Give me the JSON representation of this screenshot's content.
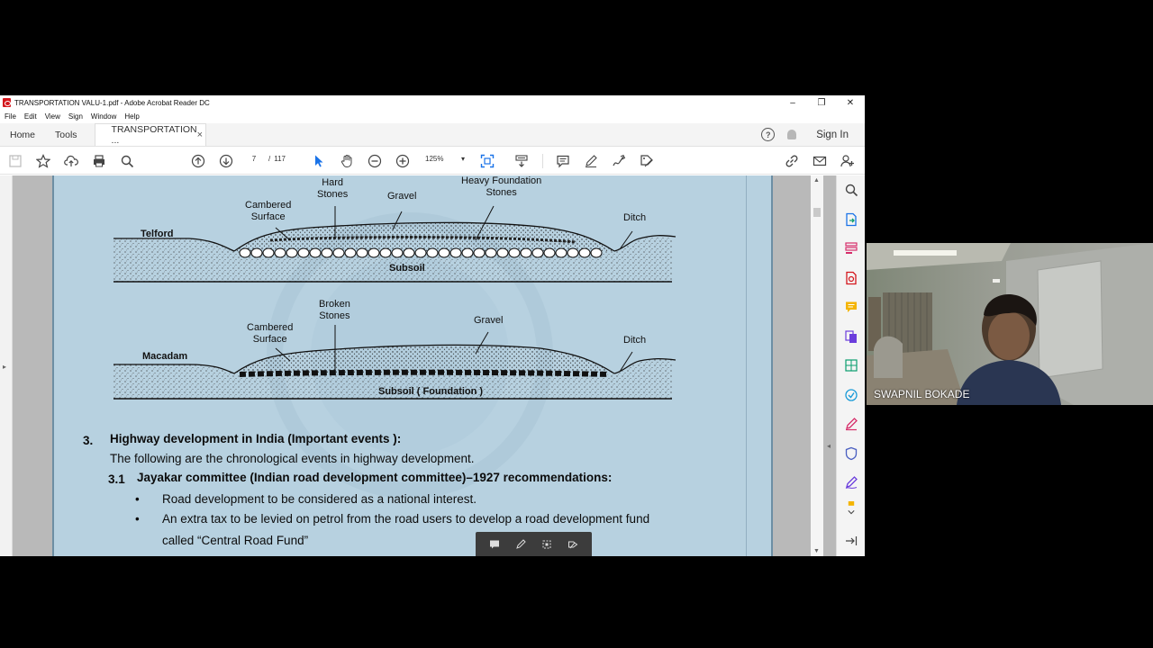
{
  "window": {
    "title": "TRANSPORTATION VALU-1.pdf - Adobe Acrobat Reader DC",
    "controls": [
      "–",
      "❐",
      "✕"
    ]
  },
  "menu": [
    "File",
    "Edit",
    "View",
    "Sign",
    "Window",
    "Help"
  ],
  "tabs": {
    "home": "Home",
    "tools": "Tools",
    "document": "TRANSPORTATION ...",
    "close": "×",
    "sign_in": "Sign In",
    "help": "?"
  },
  "toolbar": {
    "current_page": "7",
    "page_sep": "/",
    "total_pages": "117",
    "zoom": "125%",
    "zoom_caret": "▾"
  },
  "figure1": {
    "road_type": "Telford",
    "labels": {
      "cambered_surface": "Cambered\nSurface",
      "hard_stones": "Hard\nStones",
      "gravel": "Gravel",
      "heavy_foundation": "Heavy Foundation\nStones",
      "ditch": "Ditch",
      "subsoil": "Subsoil"
    }
  },
  "figure2": {
    "road_type": "Macadam",
    "labels": {
      "cambered_surface": "Cambered\nSurface",
      "broken_stones": "Broken\nStones",
      "gravel": "Gravel",
      "ditch": "Ditch",
      "subsoil": "Subsoil ( Foundation )"
    }
  },
  "section3": {
    "number": "3.",
    "heading": "Highway development in India (Important events ):",
    "intro": "The following are the chronological events in highway development.",
    "sub_number": "3.1",
    "sub_heading": "Jayakar committee (Indian road development committee)–1927 recommendations:",
    "bullets": [
      "Road development to be considered as a national interest.",
      "An extra tax to be levied on petrol from the road users to develop a road development fund"
    ],
    "bullet_cont": "called “Central Road Fund”"
  },
  "webcam": {
    "participant_name": "SWAPNIL BOKADE"
  },
  "colors": {
    "page_bg": "#b7d1e0",
    "accent_blue": "#1a73e8",
    "pdf_red": "#d4161c"
  }
}
